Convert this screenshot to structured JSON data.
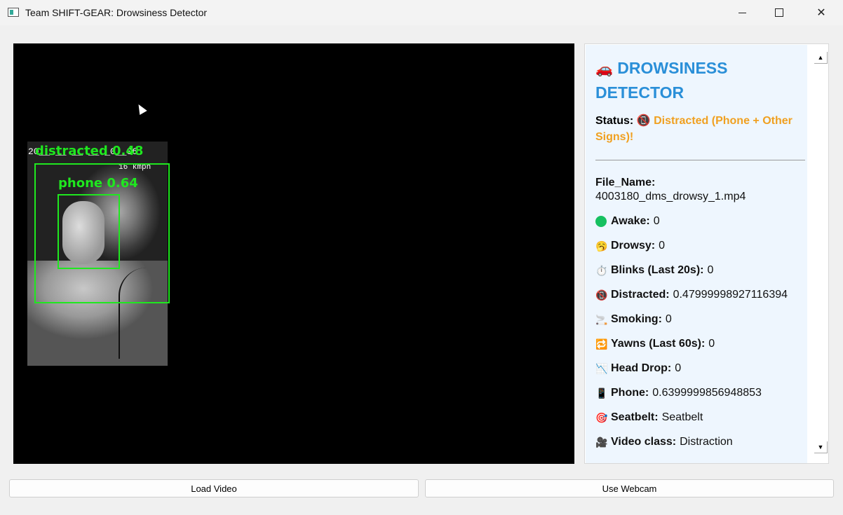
{
  "window": {
    "title": "Team SHIFT-GEAR: Drowsiness Detector",
    "minimize_glyph": "",
    "maximize_glyph": "",
    "close_glyph": "✕"
  },
  "video": {
    "timestamp": "20__ __ __ __ _0__06",
    "speed": "16 kmph",
    "detections": [
      {
        "label": "distracted 0.48"
      },
      {
        "label": "phone 0.64"
      }
    ]
  },
  "info": {
    "heading_icon": "🚗",
    "heading": "DROWSINESS DETECTOR",
    "status_key": "Status:",
    "status_icon": "📵",
    "status_value": "Distracted (Phone + Other Signs)!",
    "file_key": "File_Name:",
    "file_value": "4003180_dms_drowsy_1.mp4",
    "rows": [
      {
        "icon": "green-dot",
        "key": "Awake:",
        "value": "0"
      },
      {
        "icon": "🥱",
        "key": "Drowsy:",
        "value": "0"
      },
      {
        "icon": "⏱️",
        "key": "Blinks (Last 20s):",
        "value": "0"
      },
      {
        "icon": "📵",
        "key": "Distracted:",
        "value": "0.47999998927116394"
      },
      {
        "icon": "🚬",
        "key": "Smoking:",
        "value": "0"
      },
      {
        "icon": "🔁",
        "key": "Yawns (Last 60s):",
        "value": "0"
      },
      {
        "icon": "📉",
        "key": "Head Drop:",
        "value": "0"
      },
      {
        "icon": "📱",
        "key": "Phone:",
        "value": "0.6399999856948853"
      },
      {
        "icon": "🎯",
        "key": "Seatbelt:",
        "value": "Seatbelt"
      },
      {
        "icon": "🎥",
        "key": "Video class:",
        "value": "Distraction"
      }
    ],
    "scroll_up": "▲",
    "scroll_down": "▼"
  },
  "buttons": {
    "load_video": "Load Video",
    "use_webcam": "Use Webcam"
  },
  "colors": {
    "accent": "#2a8fd8",
    "status": "#f0a020",
    "bbox": "#1fe81f"
  }
}
